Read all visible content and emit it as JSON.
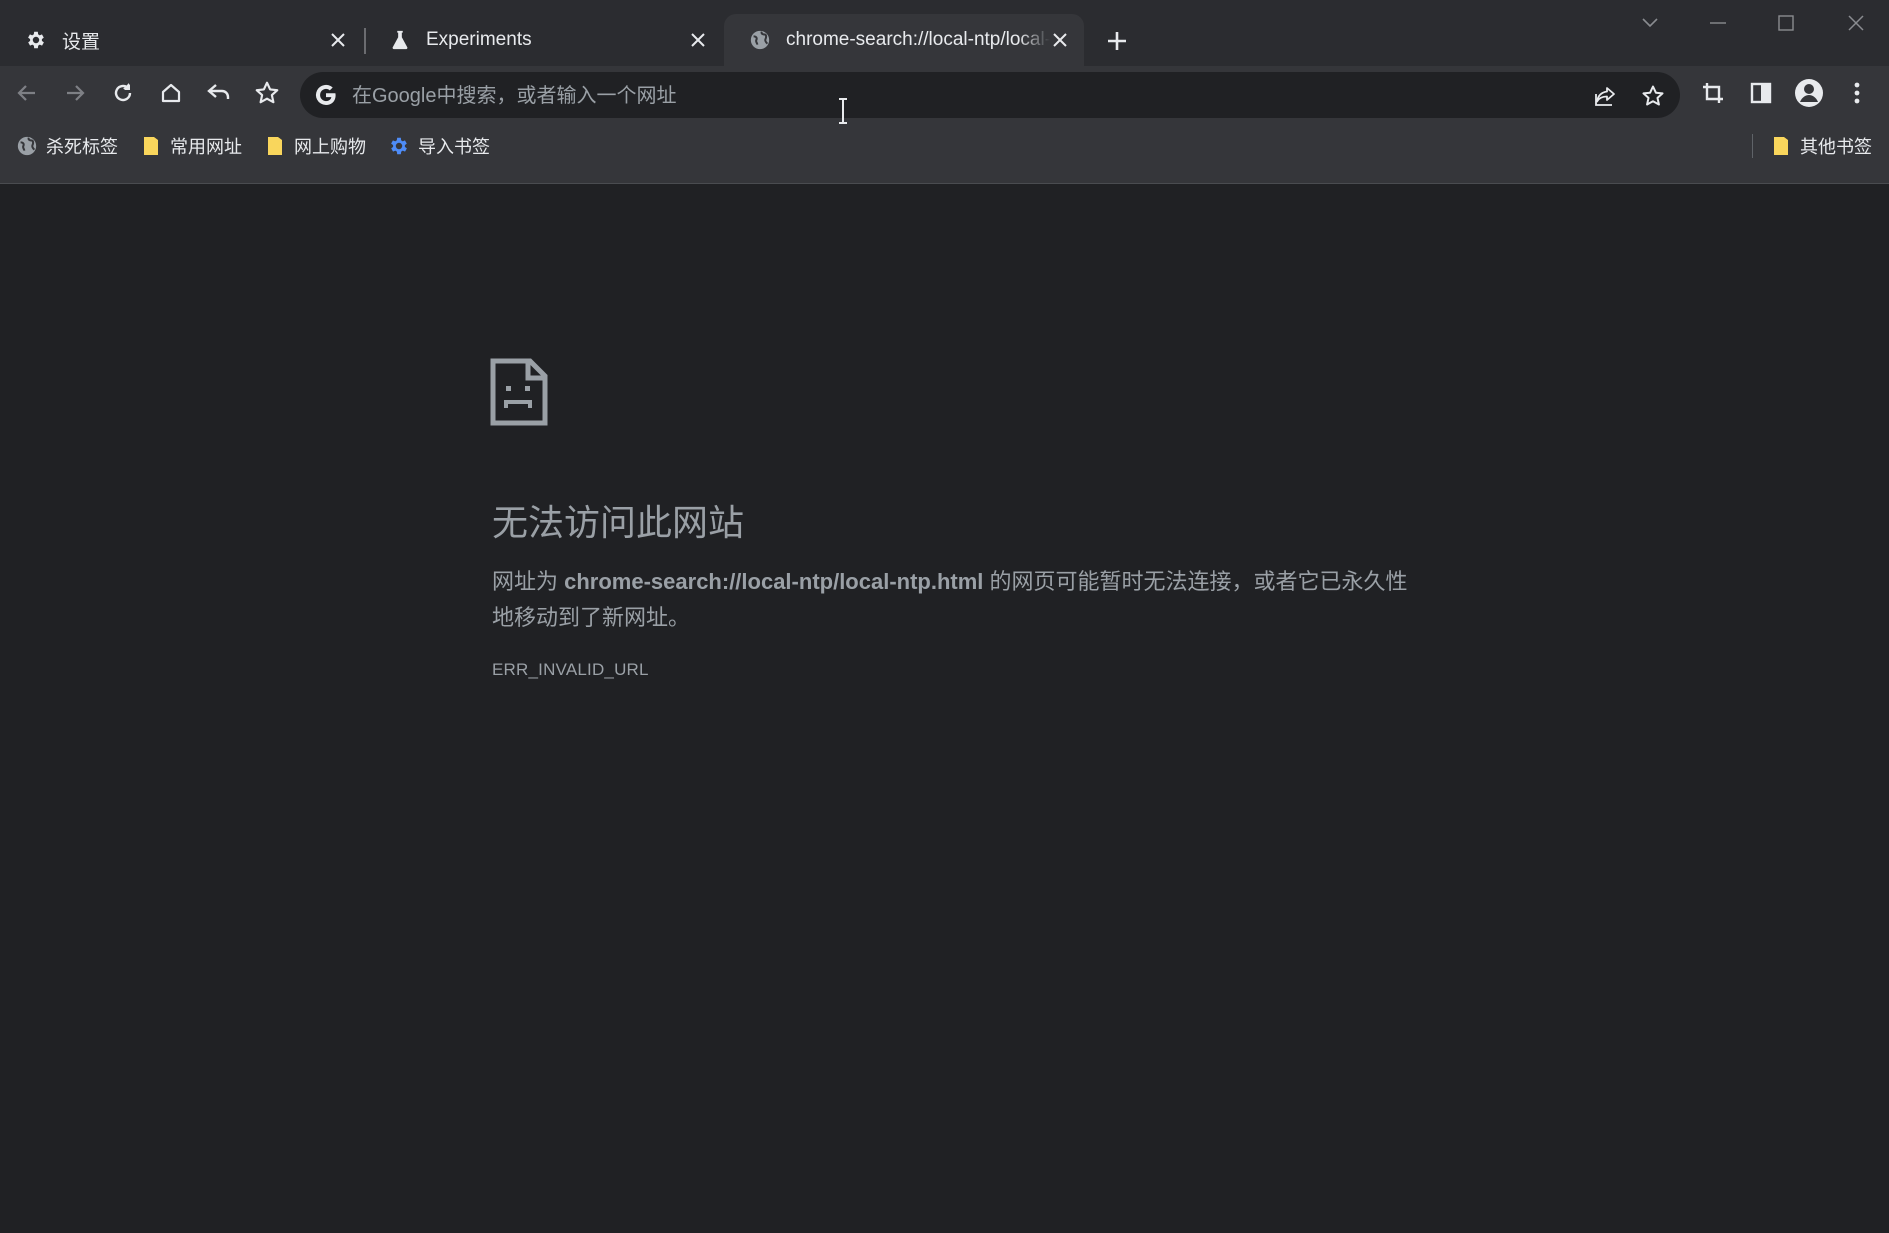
{
  "tabs": [
    {
      "title": "设置",
      "icon": "gear-icon"
    },
    {
      "title": "Experiments",
      "icon": "flask-icon"
    },
    {
      "title": "chrome-search://local-ntp/local-ntp.html",
      "icon": "globe-icon",
      "active": true
    }
  ],
  "omnibox": {
    "value": "",
    "placeholder": "在Google中搜索，或者输入一个网址"
  },
  "bookmarks": [
    {
      "label": "杀死标签",
      "icon": "globe-icon"
    },
    {
      "label": "常用网址",
      "icon": "folder-icon"
    },
    {
      "label": "网上购物",
      "icon": "folder-icon"
    },
    {
      "label": "导入书签",
      "icon": "gear-icon"
    }
  ],
  "other_bookmarks": {
    "label": "其他书签",
    "icon": "folder-icon"
  },
  "error": {
    "title": "无法访问此网站",
    "message_prefix": "网址为 ",
    "url": "chrome-search://local-ntp/local-ntp.html",
    "message_suffix": " 的网页可能暂时无法连接，或者它已永久性地移动到了新网址。",
    "code": "ERR_INVALID_URL"
  },
  "colors": {
    "page_background": "#202124",
    "toolbar": "#35363a",
    "tabstrip": "#2b2c30",
    "muted_text": "#9aa0a6",
    "folder": "#f9d65c",
    "link_blue": "#4e8cf7"
  }
}
